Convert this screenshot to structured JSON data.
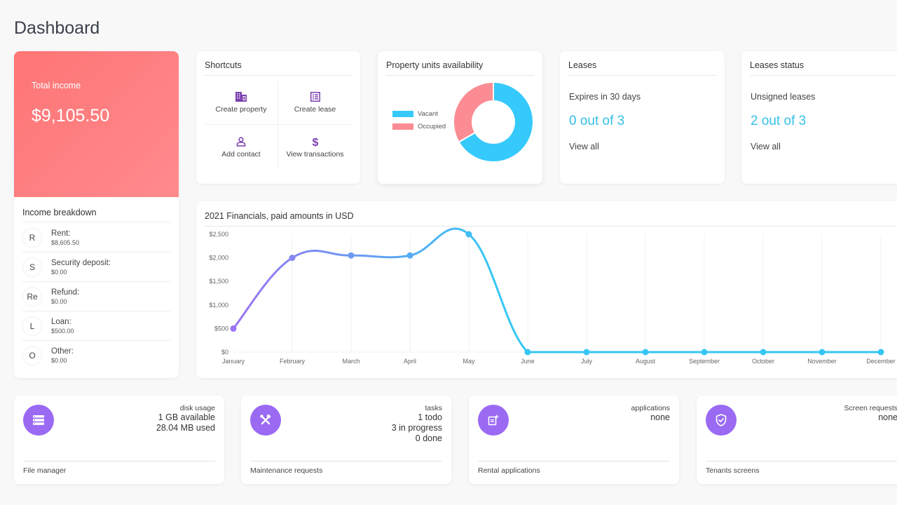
{
  "page": {
    "title": "Dashboard"
  },
  "income": {
    "label": "Total income",
    "value": "$9,105.50",
    "breakdown_title": "Income breakdown",
    "items": [
      {
        "initial": "R",
        "label": "Rent:",
        "value": "$8,605.50"
      },
      {
        "initial": "S",
        "label": "Security deposit:",
        "value": "$0.00"
      },
      {
        "initial": "Re",
        "label": "Refund:",
        "value": "$0.00"
      },
      {
        "initial": "L",
        "label": "Loan:",
        "value": "$500.00"
      },
      {
        "initial": "O",
        "label": "Other:",
        "value": "$0.00"
      }
    ]
  },
  "shortcuts": {
    "title": "Shortcuts",
    "items": [
      {
        "label": "Create property",
        "icon": "building-icon"
      },
      {
        "label": "Create lease",
        "icon": "list-document-icon"
      },
      {
        "label": "Add contact",
        "icon": "person-icon"
      },
      {
        "label": "View transactions",
        "icon": "dollar-icon"
      }
    ],
    "icon_color": "#7b3fb0"
  },
  "units": {
    "title": "Property units availability",
    "legend": [
      {
        "label": "Vacant",
        "color": "#36c9fb"
      },
      {
        "label": "Occupied",
        "color": "#fb8c94"
      }
    ],
    "values": {
      "Vacant": 2,
      "Occupied": 1
    }
  },
  "leases": {
    "title": "Leases",
    "subtitle": "Expires in 30 days",
    "count": "0 out of 3",
    "link": "View all"
  },
  "leases_status": {
    "title": "Leases status",
    "subtitle": "Unsigned leases",
    "count": "2 out of 3",
    "link": "View all"
  },
  "chart_data": {
    "type": "line",
    "title": "2021 Financials, paid amounts in USD",
    "categories": [
      "January",
      "February",
      "March",
      "April",
      "May",
      "June",
      "July",
      "August",
      "September",
      "October",
      "November",
      "December"
    ],
    "series": [
      {
        "name": "Paid amounts",
        "values": [
          500,
          2000,
          2050,
          2050,
          2500,
          0,
          0,
          0,
          0,
          0,
          0,
          0
        ]
      }
    ],
    "xlabel": "",
    "ylabel": "",
    "ylim": [
      0,
      2500
    ],
    "yticks": [
      "$0",
      "$500",
      "$1,000",
      "$1,500",
      "$2,000",
      "$2,500"
    ],
    "ytick_values": [
      0,
      500,
      1000,
      1500,
      2000,
      2500
    ],
    "grid": "vertical",
    "gradient_colors": [
      "#9b73f3",
      "#36c6f4"
    ]
  },
  "bottom_cards": [
    {
      "icon": "server-list-icon",
      "caption": "disk usage",
      "lines": [
        "1 GB available",
        "28.04 MB used"
      ],
      "footer": "File manager"
    },
    {
      "icon": "tools-icon",
      "caption": "tasks",
      "lines": [
        "1 todo",
        "3 in progress",
        "0 done"
      ],
      "footer": "Maintenance requests"
    },
    {
      "icon": "application-add-icon",
      "caption": "applications",
      "lines": [
        "none"
      ],
      "footer": "Rental applications"
    },
    {
      "icon": "shield-check-icon",
      "caption": "Screen requests",
      "lines": [
        "none"
      ],
      "footer": "Tenants screens"
    }
  ]
}
